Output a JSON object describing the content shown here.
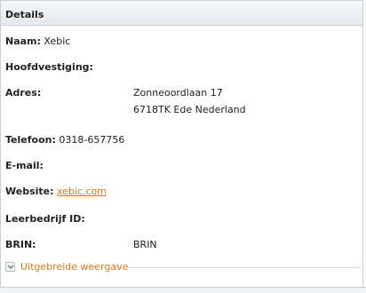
{
  "panel": {
    "title": "Details"
  },
  "fields": {
    "naam": {
      "label": "Naam:",
      "value": "Xebic"
    },
    "hoofdvestiging": {
      "label": "Hoofdvestiging:",
      "value": ""
    },
    "adres": {
      "label": "Adres:",
      "line1": "Zonneoordlaan 17",
      "line2": "6718TK Ede Nederland"
    },
    "telefoon": {
      "label": "Telefoon:",
      "value": "0318-657756"
    },
    "email": {
      "label": "E-mail:",
      "value": ""
    },
    "website": {
      "label": "Website:",
      "value": "xebic.com"
    },
    "leerbedrijf": {
      "label": "Leerbedrijf ID:",
      "value": ""
    },
    "brin": {
      "label": "BRIN:",
      "value": "BRIN"
    }
  },
  "footer": {
    "expand_label": "Uitgebreide weergave",
    "expand_icon": "chevron-down-icon"
  },
  "colors": {
    "link": "#d47a1c",
    "border": "#c9d0d8"
  }
}
